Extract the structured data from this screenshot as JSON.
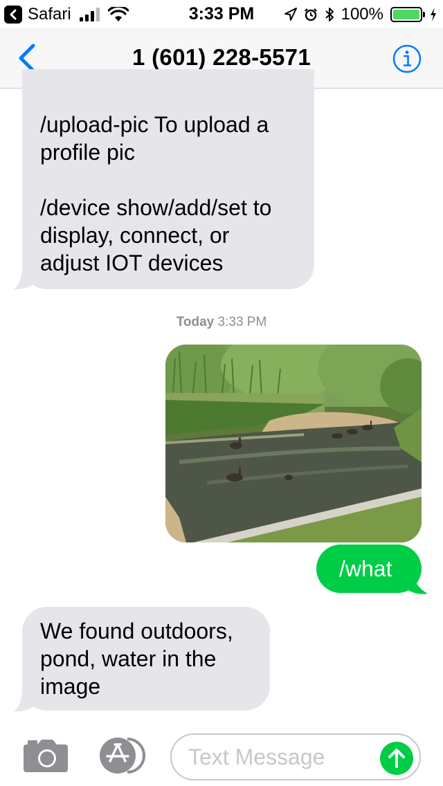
{
  "status_bar": {
    "back_app": "Safari",
    "time": "3:33 PM",
    "battery_percent": "100%",
    "battery_level": 1.0,
    "signal_bars_on": 3,
    "signal_bars_total": 4,
    "icons": [
      "back-arrow-icon",
      "signal-icon",
      "wifi-icon",
      "location-icon",
      "alarm-icon",
      "bluetooth-icon",
      "battery-icon",
      "charging-icon"
    ]
  },
  "nav": {
    "title": "1 (601) 228-5571",
    "back_icon": "chevron-left-icon",
    "info_icon": "info-icon"
  },
  "messages": {
    "first": {
      "direction": "incoming",
      "para1": [
        "/upload-pic To upload a",
        "profile pic"
      ],
      "para2": [
        "/device show/add/set to",
        "display, connect, or",
        "adjust IOT devices"
      ]
    },
    "timestamp": {
      "day": "Today",
      "time": "3:33 PM"
    },
    "photo": {
      "direction": "outgoing",
      "icon": "photo-geese-pond"
    },
    "what": {
      "direction": "outgoing",
      "text": "/what"
    },
    "reply": {
      "direction": "incoming",
      "lines": [
        "We found outdoors,",
        "pond, water in the",
        "image"
      ]
    }
  },
  "input_bar": {
    "placeholder": "Text Message",
    "value": "",
    "camera_icon": "camera-icon",
    "apps_icon": "app-store-icon",
    "send_icon": "send-arrow-icon"
  },
  "colors": {
    "accent": "#007aff",
    "incoming_bubble": "#e5e5ea",
    "outgoing_bubble": "#00cd46",
    "battery": "#4cd964"
  }
}
